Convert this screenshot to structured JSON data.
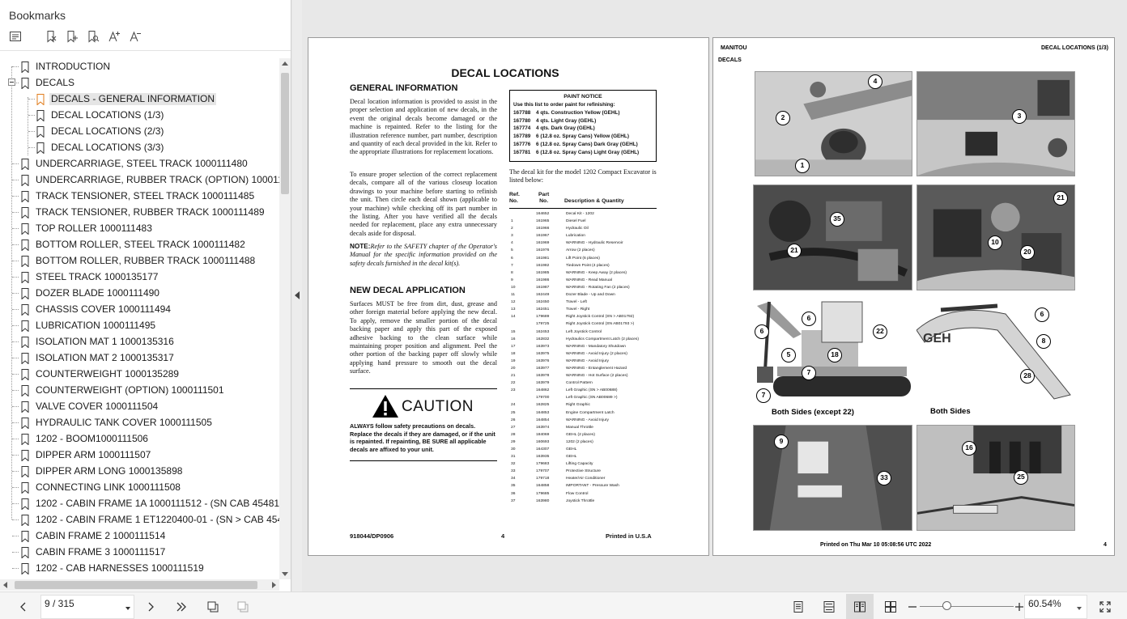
{
  "sidebar": {
    "title": "Bookmarks",
    "tools": [
      {
        "icon": "bookmark-list-icon"
      },
      {
        "icon": "delete-bookmark-icon"
      },
      {
        "icon": "add-bookmark-icon"
      },
      {
        "icon": "find-bookmark-icon"
      },
      {
        "icon": "increase-text-size-icon",
        "label": "A+"
      },
      {
        "icon": "decrease-text-size-icon",
        "label": "A-"
      }
    ],
    "bookmarks": [
      {
        "label": "INTRODUCTION",
        "level": 0
      },
      {
        "label": "DECALS",
        "level": 0,
        "expanded": true
      },
      {
        "label": "DECALS - GENERAL INFORMATION",
        "level": 1,
        "selected": true
      },
      {
        "label": "DECAL LOCATIONS (1/3)",
        "level": 1
      },
      {
        "label": "DECAL LOCATIONS (2/3)",
        "level": 1
      },
      {
        "label": "DECAL LOCATIONS (3/3)",
        "level": 1
      },
      {
        "label": "UNDERCARRIAGE, STEEL TRACK 1000111480",
        "level": 0
      },
      {
        "label": "UNDERCARRIAGE, RUBBER TRACK (OPTION) 1000111487",
        "level": 0
      },
      {
        "label": "TRACK TENSIONER, STEEL TRACK 1000111485",
        "level": 0
      },
      {
        "label": "TRACK TENSIONER, RUBBER TRACK 1000111489",
        "level": 0
      },
      {
        "label": "TOP ROLLER 1000111483",
        "level": 0
      },
      {
        "label": "BOTTOM ROLLER, STEEL TRACK 1000111482",
        "level": 0
      },
      {
        "label": "BOTTOM ROLLER, RUBBER TRACK 1000111488",
        "level": 0
      },
      {
        "label": "STEEL TRACK 1000135177",
        "level": 0
      },
      {
        "label": "DOZER BLADE 1000111490",
        "level": 0
      },
      {
        "label": "CHASSIS COVER 1000111494",
        "level": 0
      },
      {
        "label": "LUBRICATION 1000111495",
        "level": 0
      },
      {
        "label": "ISOLATION MAT 1 1000135316",
        "level": 0
      },
      {
        "label": "ISOLATION MAT 2 1000135317",
        "level": 0
      },
      {
        "label": "COUNTERWEIGHT 1000135289",
        "level": 0
      },
      {
        "label": "COUNTERWEIGHT (OPTION) 1000111501",
        "level": 0
      },
      {
        "label": "VALVE COVER 1000111504",
        "level": 0
      },
      {
        "label": "HYDRAULIC TANK COVER 1000111505",
        "level": 0
      },
      {
        "label": "1202 - BOOM1000111506",
        "level": 0
      },
      {
        "label": "DIPPER ARM 1000111507",
        "level": 0
      },
      {
        "label": "DIPPER ARM LONG 1000135898",
        "level": 0
      },
      {
        "label": "CONNECTING LINK 1000111508",
        "level": 0
      },
      {
        "label": "1202 - CABIN FRAME 1A 1000111512 - (SN CAB 45481 >)",
        "level": 0
      },
      {
        "label": "1202 - CABIN FRAME 1 ET1220400-01 - (SN > CAB 45480)",
        "level": 0
      },
      {
        "label": "CABIN FRAME 2 1000111514",
        "level": 0
      },
      {
        "label": "CABIN FRAME 3 1000111517",
        "level": 0
      },
      {
        "label": "1202 - CAB HARNESSES 1000111519",
        "level": 0
      }
    ]
  },
  "page_left": {
    "title": "DECAL LOCATIONS",
    "general_heading": "GENERAL INFORMATION",
    "general_p1": "Decal location information is provided to assist in the proper selection and application of new decals, in the event the original decals become damaged or the machine is repainted. Refer to the listing for the illustration reference number, part number, description and quantity of each decal provided in the kit. Refer to the appropriate illustrations for replacement locations.",
    "general_p2": "To ensure proper selection of the correct replacement decals, compare all of the various closeup location drawings to your machine before starting to refinish the unit. Then circle each decal shown (applicable to your machine) while checking off its part number in the listing. After you have verified all the decals needed for replacement, place any extra unnecessary decals aside for disposal.",
    "note_label": "NOTE:",
    "note_text": "Refer to the SAFETY chapter of the Operator's Manual for the specific information provided on the safety decals furnished in the decal kit(s).",
    "new_heading": "NEW DECAL APPLICATION",
    "new_p": "Surfaces MUST be free from dirt, dust, grease and other foreign material before applying the new decal. To apply, remove the smaller portion of the decal backing paper and apply this part of the exposed adhesive backing to the clean surface while maintaining proper position and alignment. Peel the other portion of the backing paper off slowly while applying hand pressure to smooth out the decal surface.",
    "caution_word": "CAUTION",
    "caution_text": "ALWAYS follow safety precautions on decals. Replace the decals if they are damaged, or if the unit is repainted. If repainting, BE SURE all applicable decals are affixed to your unit.",
    "paint_title": "PAINT NOTICE",
    "paint_sub": "Use this list to order paint for refinishing:",
    "paint_rows": [
      {
        "part": "167788",
        "desc": "4 qts. Construction Yellow (GEHL)"
      },
      {
        "part": "167780",
        "desc": "4 qts. Light Gray (GEHL)"
      },
      {
        "part": "167774",
        "desc": "4 qts. Dark Gray (GEHL)"
      },
      {
        "part": "167789",
        "desc": "6 (12.8 oz. Spray Cans) Yellow (GEHL)"
      },
      {
        "part": "167776",
        "desc": "6 (12.8 oz. Spray Cans) Dark Gray (GEHL)"
      },
      {
        "part": "167781",
        "desc": "6 (12.8 oz. Spray Cans) Light Gray (GEHL)"
      }
    ],
    "kit_intro": "The decal kit for the model 1202 Compact Excavator is listed below:",
    "parts_head": {
      "ref": "Ref.\nNo.",
      "part": "Part\nNo.",
      "desc": "Description & Quantity"
    },
    "parts": [
      {
        "ref": "",
        "part": "164652",
        "desc": "Decal Kit - 1202"
      },
      {
        "ref": "1",
        "part": "161965",
        "desc": "Diesel Fuel"
      },
      {
        "ref": "2",
        "part": "161966",
        "desc": "Hydraulic Oil"
      },
      {
        "ref": "3",
        "part": "161967",
        "desc": "Lubrication"
      },
      {
        "ref": "4",
        "part": "161969",
        "desc": "WARNING - Hydraulic Reservoir"
      },
      {
        "ref": "5",
        "part": "161976",
        "desc": "Arrow (2 places)"
      },
      {
        "ref": "6",
        "part": "161981",
        "desc": "Lift Point (6 places)"
      },
      {
        "ref": "7",
        "part": "161982",
        "desc": "Tiedown Point (4 places)"
      },
      {
        "ref": "8",
        "part": "161985",
        "desc": "WARNING - Keep Away (2 places)"
      },
      {
        "ref": "9",
        "part": "161986",
        "desc": "WARNING - Read Manual"
      },
      {
        "ref": "10",
        "part": "161987",
        "desc": "WARNING - Rotating Fan (2 places)"
      },
      {
        "ref": "11",
        "part": "162449",
        "desc": "Dozer Blade - Up and Down"
      },
      {
        "ref": "12",
        "part": "162450",
        "desc": "Travel - Left"
      },
      {
        "ref": "13",
        "part": "162451",
        "desc": "Travel - Right"
      },
      {
        "ref": "14",
        "part": "179689",
        "desc": "Right Joystick Control (SN > AB01792)"
      },
      {
        "ref": "",
        "part": "179725",
        "desc": "Right Joystick Control (SN AB01793 >)"
      },
      {
        "ref": "15",
        "part": "162453",
        "desc": "Left Joystick Control"
      },
      {
        "ref": "16",
        "part": "162832",
        "desc": "Hydraulics Compartment Latch (2 places)"
      },
      {
        "ref": "17",
        "part": "163973",
        "desc": "WARNING - Mandatory Shutdown"
      },
      {
        "ref": "18",
        "part": "163975",
        "desc": "WARNING - Avoid Injury (2 places)"
      },
      {
        "ref": "19",
        "part": "163976",
        "desc": "WARNING - Avoid Injury"
      },
      {
        "ref": "20",
        "part": "163977",
        "desc": "WARNING - Entanglement Hazard"
      },
      {
        "ref": "21",
        "part": "163978",
        "desc": "WARNING - Hot Surface (2 places)"
      },
      {
        "ref": "22",
        "part": "163979",
        "desc": "Control Pattern"
      },
      {
        "ref": "23",
        "part": "164862",
        "desc": "Left Graphic (SN > AB00688)"
      },
      {
        "ref": "",
        "part": "179700",
        "desc": "Left Graphic (SN AB00689 >)"
      },
      {
        "ref": "24",
        "part": "162825",
        "desc": "Right Graphic"
      },
      {
        "ref": "25",
        "part": "164853",
        "desc": "Engine Compartment Latch"
      },
      {
        "ref": "26",
        "part": "164854",
        "desc": "WARNING - Avoid Injury"
      },
      {
        "ref": "27",
        "part": "163974",
        "desc": "Manual Throttle"
      },
      {
        "ref": "28",
        "part": "184069",
        "desc": "GEHL (2 places)"
      },
      {
        "ref": "29",
        "part": "160693",
        "desc": "1202 (2 places)"
      },
      {
        "ref": "30",
        "part": "164307",
        "desc": "GEHL"
      },
      {
        "ref": "31",
        "part": "163935",
        "desc": "GEHL"
      },
      {
        "ref": "32",
        "part": "179683",
        "desc": "Lifting Capacity"
      },
      {
        "ref": "33",
        "part": "179707",
        "desc": "Protective Structure"
      },
      {
        "ref": "34",
        "part": "179718",
        "desc": "Heater/Air Conditioner"
      },
      {
        "ref": "35",
        "part": "164858",
        "desc": "IMPORTANT - Pressure Wash"
      },
      {
        "ref": "36",
        "part": "179685",
        "desc": "Flow Control"
      },
      {
        "ref": "37",
        "part": "163980",
        "desc": "Joystick Throttle"
      }
    ],
    "footer_left": "918044/DP0906",
    "footer_center": "4",
    "footer_right": "Printed in U.S.A"
  },
  "page_right": {
    "brand": "MANITOU",
    "section": "DECALS",
    "header_right": "DECAL LOCATIONS (1/3)",
    "caption_left": "Both Sides (except 22)",
    "caption_right": "Both Sides",
    "footer_center": "Printed on  Thu Mar 10 05:08:56 UTC 2022",
    "footer_right": "4",
    "callouts": [
      "4",
      "2",
      "1",
      "3",
      "35",
      "21",
      "21",
      "10",
      "20",
      "6",
      "6",
      "22",
      "5",
      "18",
      "7",
      "7",
      "6",
      "8",
      "28",
      "9",
      "33",
      "16",
      "25"
    ]
  },
  "bottombar": {
    "page_value": "9 / 315",
    "zoom_value": "60.54%"
  }
}
